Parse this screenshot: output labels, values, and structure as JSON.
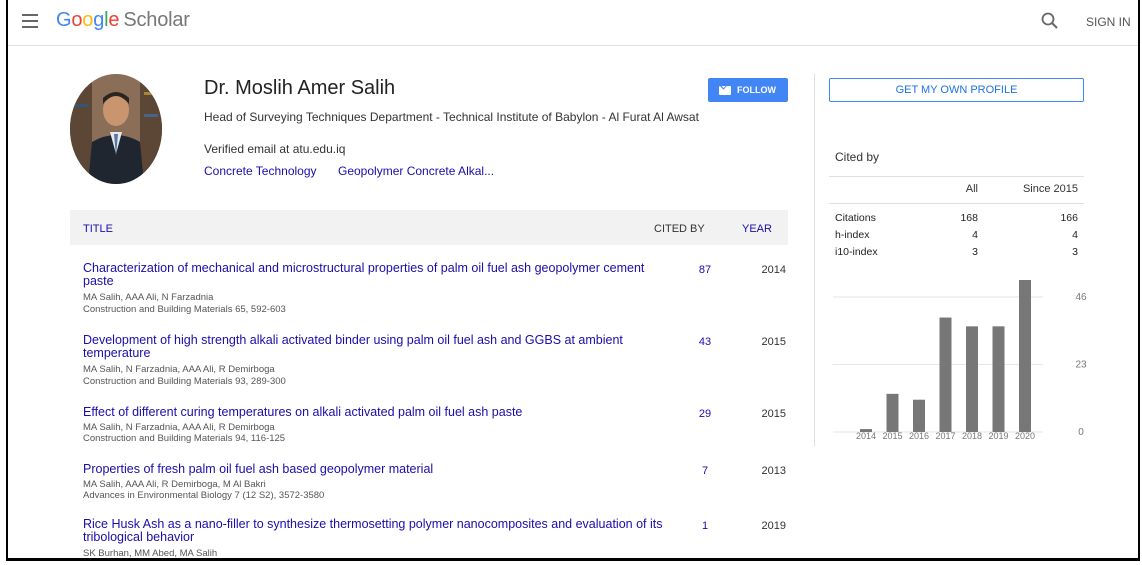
{
  "header": {
    "logo_parts": [
      "G",
      "o",
      "o",
      "g",
      "l",
      "e"
    ],
    "logo_scholar": "Scholar",
    "signin": "SIGN IN"
  },
  "profile": {
    "name": "Dr. Moslih Amer Salih",
    "affiliation": "Head of Surveying Techniques Department - Technical Institute of Babylon - Al Furat Al Awsat",
    "email": "Verified email at atu.edu.iq",
    "interests": [
      "Concrete Technology",
      "Geopolymer Concrete Alkal..."
    ],
    "follow": "FOLLOW"
  },
  "table": {
    "col_title": "TITLE",
    "col_cited": "CITED BY",
    "col_year": "YEAR",
    "articles": [
      {
        "title": "Characterization of mechanical and microstructural properties of palm oil fuel ash geopolymer cement paste",
        "authors": "MA Salih, AAA Ali, N Farzadnia",
        "venue": "Construction and Building Materials 65, 592-603",
        "cited": "87",
        "year": "2014"
      },
      {
        "title": "Development of high strength alkali activated binder using palm oil fuel ash and GGBS at ambient temperature",
        "authors": "MA Salih, N Farzadnia, AAA Ali, R Demirboga",
        "venue": "Construction and Building Materials 93, 289-300",
        "cited": "43",
        "year": "2015"
      },
      {
        "title": "Effect of different curing temperatures on alkali activated palm oil fuel ash paste",
        "authors": "MA Salih, N Farzadnia, AAA Ali, R Demirboga",
        "venue": "Construction and Building Materials 94, 116-125",
        "cited": "29",
        "year": "2015"
      },
      {
        "title": "Properties of fresh palm oil fuel ash based geopolymer material",
        "authors": "MA Salih, AAA Ali, R Demirboga, M Al Bakri",
        "venue": "Advances in Environmental Biology 7 (12 S2), 3572-3580",
        "cited": "7",
        "year": "2013"
      },
      {
        "title": "Rice Husk Ash as a nano-filler to synthesize thermosetting polymer nanocomposites and evaluation of its tribological behavior",
        "authors": "SK Burhan, MM Abed, MA Salih",
        "venue": "",
        "cited": "1",
        "year": "2019"
      }
    ]
  },
  "sidebar": {
    "own_profile": "GET MY OWN PROFILE",
    "cited_by": "Cited by",
    "col_all": "All",
    "col_since": "Since 2015",
    "rows": [
      {
        "label": "Citations",
        "all": "168",
        "since": "166"
      },
      {
        "label": "h-index",
        "all": "4",
        "since": "4"
      },
      {
        "label": "i10-index",
        "all": "3",
        "since": "3"
      }
    ]
  },
  "chart_data": {
    "type": "bar",
    "categories": [
      "2014",
      "2015",
      "2016",
      "2017",
      "2018",
      "2019",
      "2020"
    ],
    "values": [
      1,
      13,
      11,
      39,
      36,
      36,
      52
    ],
    "yticks": [
      0,
      23,
      46
    ],
    "ylim": [
      0,
      46
    ],
    "bar_color": "#777777"
  }
}
